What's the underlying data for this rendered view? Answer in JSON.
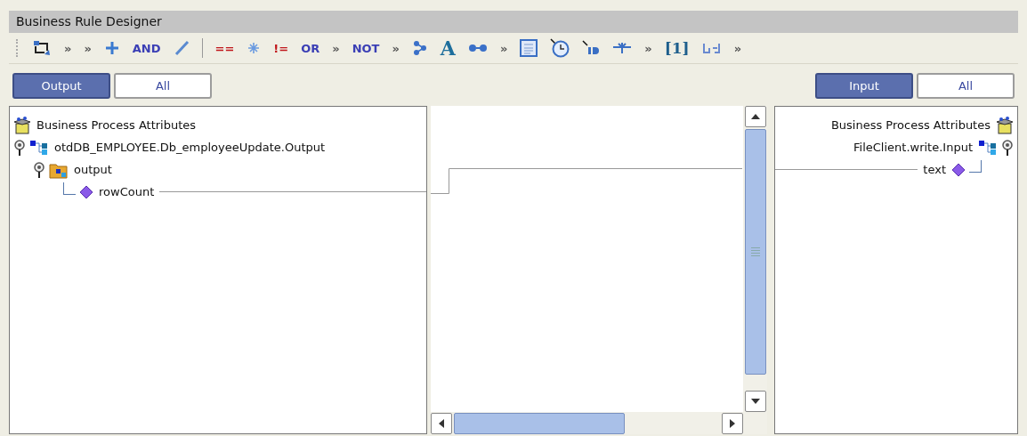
{
  "title": "Business Rule Designer",
  "toolbar": [
    {
      "kind": "icon"
    },
    {
      "kind": "text",
      "label": "»",
      "color": "#555555"
    },
    {
      "kind": "text",
      "label": "»",
      "color": "#555555"
    },
    {
      "kind": "icon"
    },
    {
      "kind": "text",
      "label": "AND",
      "color": "#3b3fb5"
    },
    {
      "kind": "icon"
    },
    {
      "kind": "separator"
    },
    {
      "kind": "text",
      "label": "==",
      "color": "#c0161b"
    },
    {
      "kind": "icon"
    },
    {
      "kind": "text",
      "label": "!=",
      "color": "#c0161b"
    },
    {
      "kind": "text",
      "label": "OR",
      "color": "#3b3fb5"
    },
    {
      "kind": "text",
      "label": "»",
      "color": "#555555"
    },
    {
      "kind": "text",
      "label": "NOT",
      "color": "#3b3fb5"
    },
    {
      "kind": "text",
      "label": "»",
      "color": "#555555"
    },
    {
      "kind": "icon"
    },
    {
      "kind": "text",
      "label": "A",
      "color": "#1d6e9c"
    },
    {
      "kind": "icon"
    },
    {
      "kind": "text",
      "label": "»",
      "color": "#555555"
    },
    {
      "kind": "icon"
    },
    {
      "kind": "icon"
    },
    {
      "kind": "icon"
    },
    {
      "kind": "icon"
    },
    {
      "kind": "text",
      "label": "»",
      "color": "#555555"
    },
    {
      "kind": "text",
      "label": "[1]",
      "color": "#1d5e8c"
    },
    {
      "kind": "icon"
    },
    {
      "kind": "text",
      "label": "»",
      "color": "#555555"
    }
  ],
  "output_filter": [
    {
      "label": "Output",
      "selected": true
    },
    {
      "label": "All",
      "selected": false
    }
  ],
  "input_filter": [
    {
      "label": "Input",
      "selected": true
    },
    {
      "label": "All",
      "selected": false
    }
  ],
  "output_tree": {
    "label": "Business Process Attributes",
    "kind": "root",
    "children": [
      {
        "label": "otdDB_EMPLOYEE.Db_employeeUpdate.Output",
        "kind": "message",
        "children": [
          {
            "label": "output",
            "kind": "folder",
            "children": [
              {
                "label": "rowCount",
                "kind": "field",
                "mapped": true
              }
            ]
          }
        ]
      }
    ]
  },
  "input_tree": {
    "label": "Business Process Attributes",
    "kind": "root",
    "children": [
      {
        "label": "FileClient.write.Input",
        "kind": "message",
        "children": [
          {
            "label": "text",
            "kind": "field",
            "mapped": true
          }
        ]
      }
    ]
  }
}
